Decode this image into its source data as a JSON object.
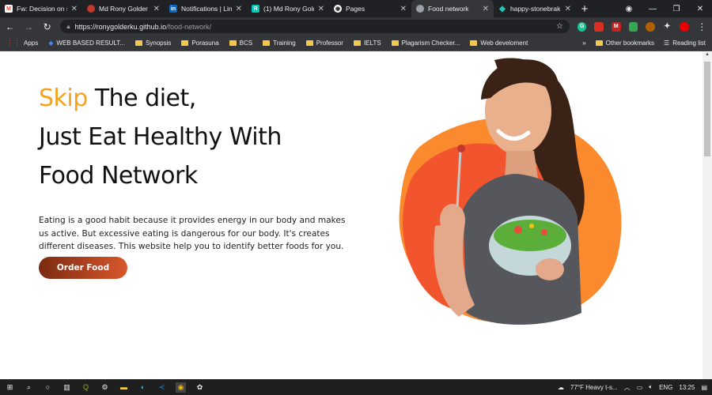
{
  "browser": {
    "tabs": [
      {
        "title": "Fw: Decision on s",
        "favicon": "gmail-icon",
        "color": "#ea4335",
        "glyph": "M"
      },
      {
        "title": "Md Rony Golder",
        "favicon": "profile-icon",
        "color": "#c0392b",
        "glyph": "●"
      },
      {
        "title": "Notifications | Lin",
        "favicon": "linkedin-icon",
        "color": "#0a66c2",
        "glyph": "in"
      },
      {
        "title": "(1) Md Rony Gold",
        "favicon": "researchgate-icon",
        "color": "#00ccbb",
        "glyph": "R"
      },
      {
        "title": "Pages",
        "favicon": "github-icon",
        "color": "#202124",
        "glyph": "◉"
      },
      {
        "title": "Food network",
        "favicon": "globe-icon",
        "color": "#9aa0a6",
        "glyph": "◍"
      },
      {
        "title": "happy-stonebrak",
        "favicon": "netlify-icon",
        "color": "#20c6b7",
        "glyph": "◆"
      }
    ],
    "new_tab": "+",
    "window_controls": [
      "—",
      "❐",
      "✕"
    ],
    "nav": {
      "back": "←",
      "forward": "→",
      "reload": "↻"
    },
    "address": {
      "host": "https://ronygolderku.github.io",
      "path": "/food-network/"
    },
    "bookmarks": [
      {
        "label": "Apps",
        "icon": "apps-icon"
      },
      {
        "label": "WEB BASED RESULT...",
        "icon": "diamond-icon"
      },
      {
        "label": "Synopsis",
        "icon": "folder-icon"
      },
      {
        "label": "Porasuna",
        "icon": "folder-icon"
      },
      {
        "label": "BCS",
        "icon": "folder-icon"
      },
      {
        "label": "Training",
        "icon": "folder-icon"
      },
      {
        "label": "Professor",
        "icon": "folder-icon"
      },
      {
        "label": "IELTS",
        "icon": "folder-icon"
      },
      {
        "label": "Plagarism Checker...",
        "icon": "folder-icon"
      },
      {
        "label": "Web develoment",
        "icon": "folder-icon"
      }
    ],
    "bookmarks_more": "»",
    "other_bookmarks": "Other bookmarks",
    "reading_list": "Reading list"
  },
  "hero": {
    "accent_word": "Skip",
    "line1_rest": " The diet,",
    "line2": "Just Eat Healthy With",
    "line3": "Food Network",
    "description": "Eating is a good habit because it provides energy in our body and makes us active. But excessive eating is dangerous for our body. It's creates different diseases. This website help you to identify better foods for you.",
    "cta_label": "Order Food"
  },
  "colors": {
    "accent": "#f7a21b",
    "blob_outer": "#fb8a2e",
    "blob_inner": "#f2542d",
    "button_start": "#7a2a12",
    "button_end": "#d9572b"
  },
  "taskbar": {
    "weather": "77°F  Heavy t-s...",
    "language": "ENG",
    "time": "13:25"
  }
}
